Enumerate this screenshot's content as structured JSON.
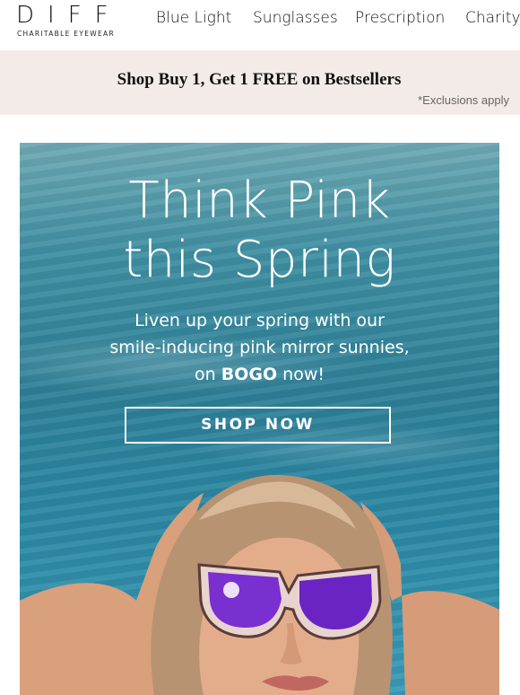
{
  "header": {
    "logo_word": "DIFF",
    "logo_sub": "CHARITABLE EYEWEAR",
    "nav": [
      "Blue Light",
      "Sunglasses",
      "Prescription",
      "Charity"
    ]
  },
  "promo": {
    "text": "Shop Buy 1, Get 1 FREE on Bestsellers",
    "note": "*Exclusions apply",
    "bg_color": "#f3ebe7"
  },
  "hero": {
    "title_line1": "Think Pink",
    "title_line2": "this Spring",
    "sub_line1": "Liven up your spring with our",
    "sub_line2": "smile-inducing pink mirror sunnies,",
    "sub_line3_pre": "on",
    "sub_line3_bold": "BOGO",
    "sub_line3_post": "now!",
    "cta_label": "SHOP NOW",
    "accent_color": "#2d7f97",
    "lens_color": "#7a2fd0"
  }
}
